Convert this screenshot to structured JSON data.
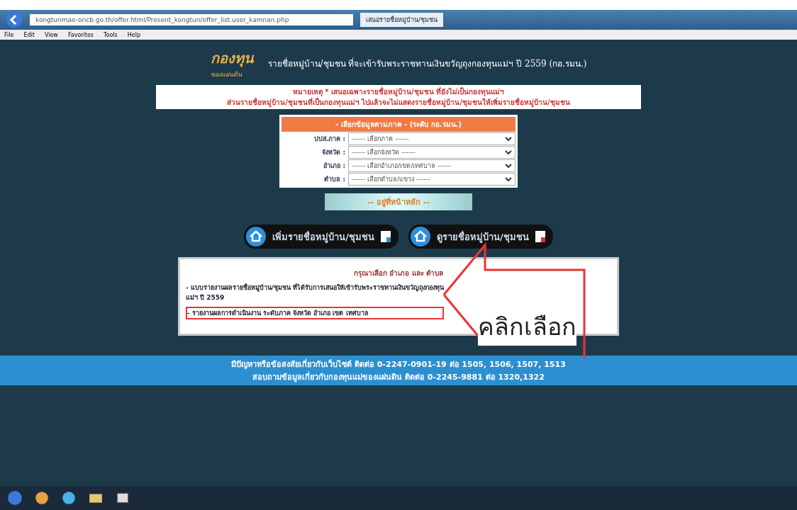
{
  "browser": {
    "address": "kongtunmae-oncb.go.th/offer.html/Present_kongtun/offer_list.user_kamnan.php",
    "tab_title": "เสนอรายชื่อหมู่บ้าน/ชุมชน",
    "menu": [
      "File",
      "Edit",
      "View",
      "Favorites",
      "Tools",
      "Help"
    ]
  },
  "header": {
    "logo_text": "กองทุน",
    "logo_sub": "ของแผ่นดิน",
    "title": "รายชื่อหมู่บ้าน/ชุมชน ที่จะเข้ารับพระราชทานเงินขวัญถุงกองทุนแม่ฯ ปี 2559 (กอ.รมน.)"
  },
  "note": [
    "หมายเหตุ * เสนอเฉพาะรายชื่อหมู่บ้าน/ชุมชน ที่ยังไม่เป็นกองทุนแม่ฯ",
    "ส่วนรายชื่อหมู่บ้าน/ชุมชนที่เป็นกองทุนแม่ฯ ไปแล้วจะไม่แสดงรายชื่อหมู่บ้าน/ชุมชนให้เพิ่มรายชื่อหมู่บ้าน/ชุมชน"
  ],
  "filter": {
    "title": "- เลือกข้อมูลตามภาค - (ระดับ กอ.รมน.)",
    "fields": [
      {
        "label": "ปปส.ภาค :",
        "value": "------ เลือกภาค ------"
      },
      {
        "label": "จังหวัด :",
        "value": "------ เลือกจังหวัด ------"
      },
      {
        "label": "อำเภอ :",
        "value": "------ เลือกอำเภอ/เขต/เทศบาล ------"
      },
      {
        "label": "ตำบล :",
        "value": "------ เลือกตำบล/แขวง ------"
      }
    ]
  },
  "banner": "-- อยู่ที่หน้าหลัก --",
  "buttons": [
    "เพิ่มรายชื่อหมู่บ้าน/ชุมชน",
    "ดูรายชื่อหมู่บ้าน/ชุมชน"
  ],
  "info": {
    "heading": "กรุณาเลือก อำเภอ และ ตำบล",
    "links": [
      {
        "text": "- แบบรายงานผลรายชื่อหมู่บ้าน/ชุมชน ที่ได้รับการเสนอให้เข้ารับพระราชทานเงินขวัญถุงกองทุนแม่ฯ ปี 2559",
        "highlighted": false
      },
      {
        "text": "- รายงานผลการดำเนินงาน ระดับภาค จังหวัด อำเภอ เขต เทศบาล",
        "highlighted": true
      }
    ]
  },
  "annotation": "คลิกเลือก",
  "footer": [
    "มีปัญหาหรือข้อสงสัยเกี่ยวกับเว็บไซต์ ติดต่อ 0-2247-0901-19 ต่อ 1505, 1506, 1507, 1513",
    "สอบถามข้อมูลเกี่ยวกับกองทุนแม่ของแผ่นดิน ติดต่อ 0-2245-9881 ต่อ 1320,1322"
  ]
}
